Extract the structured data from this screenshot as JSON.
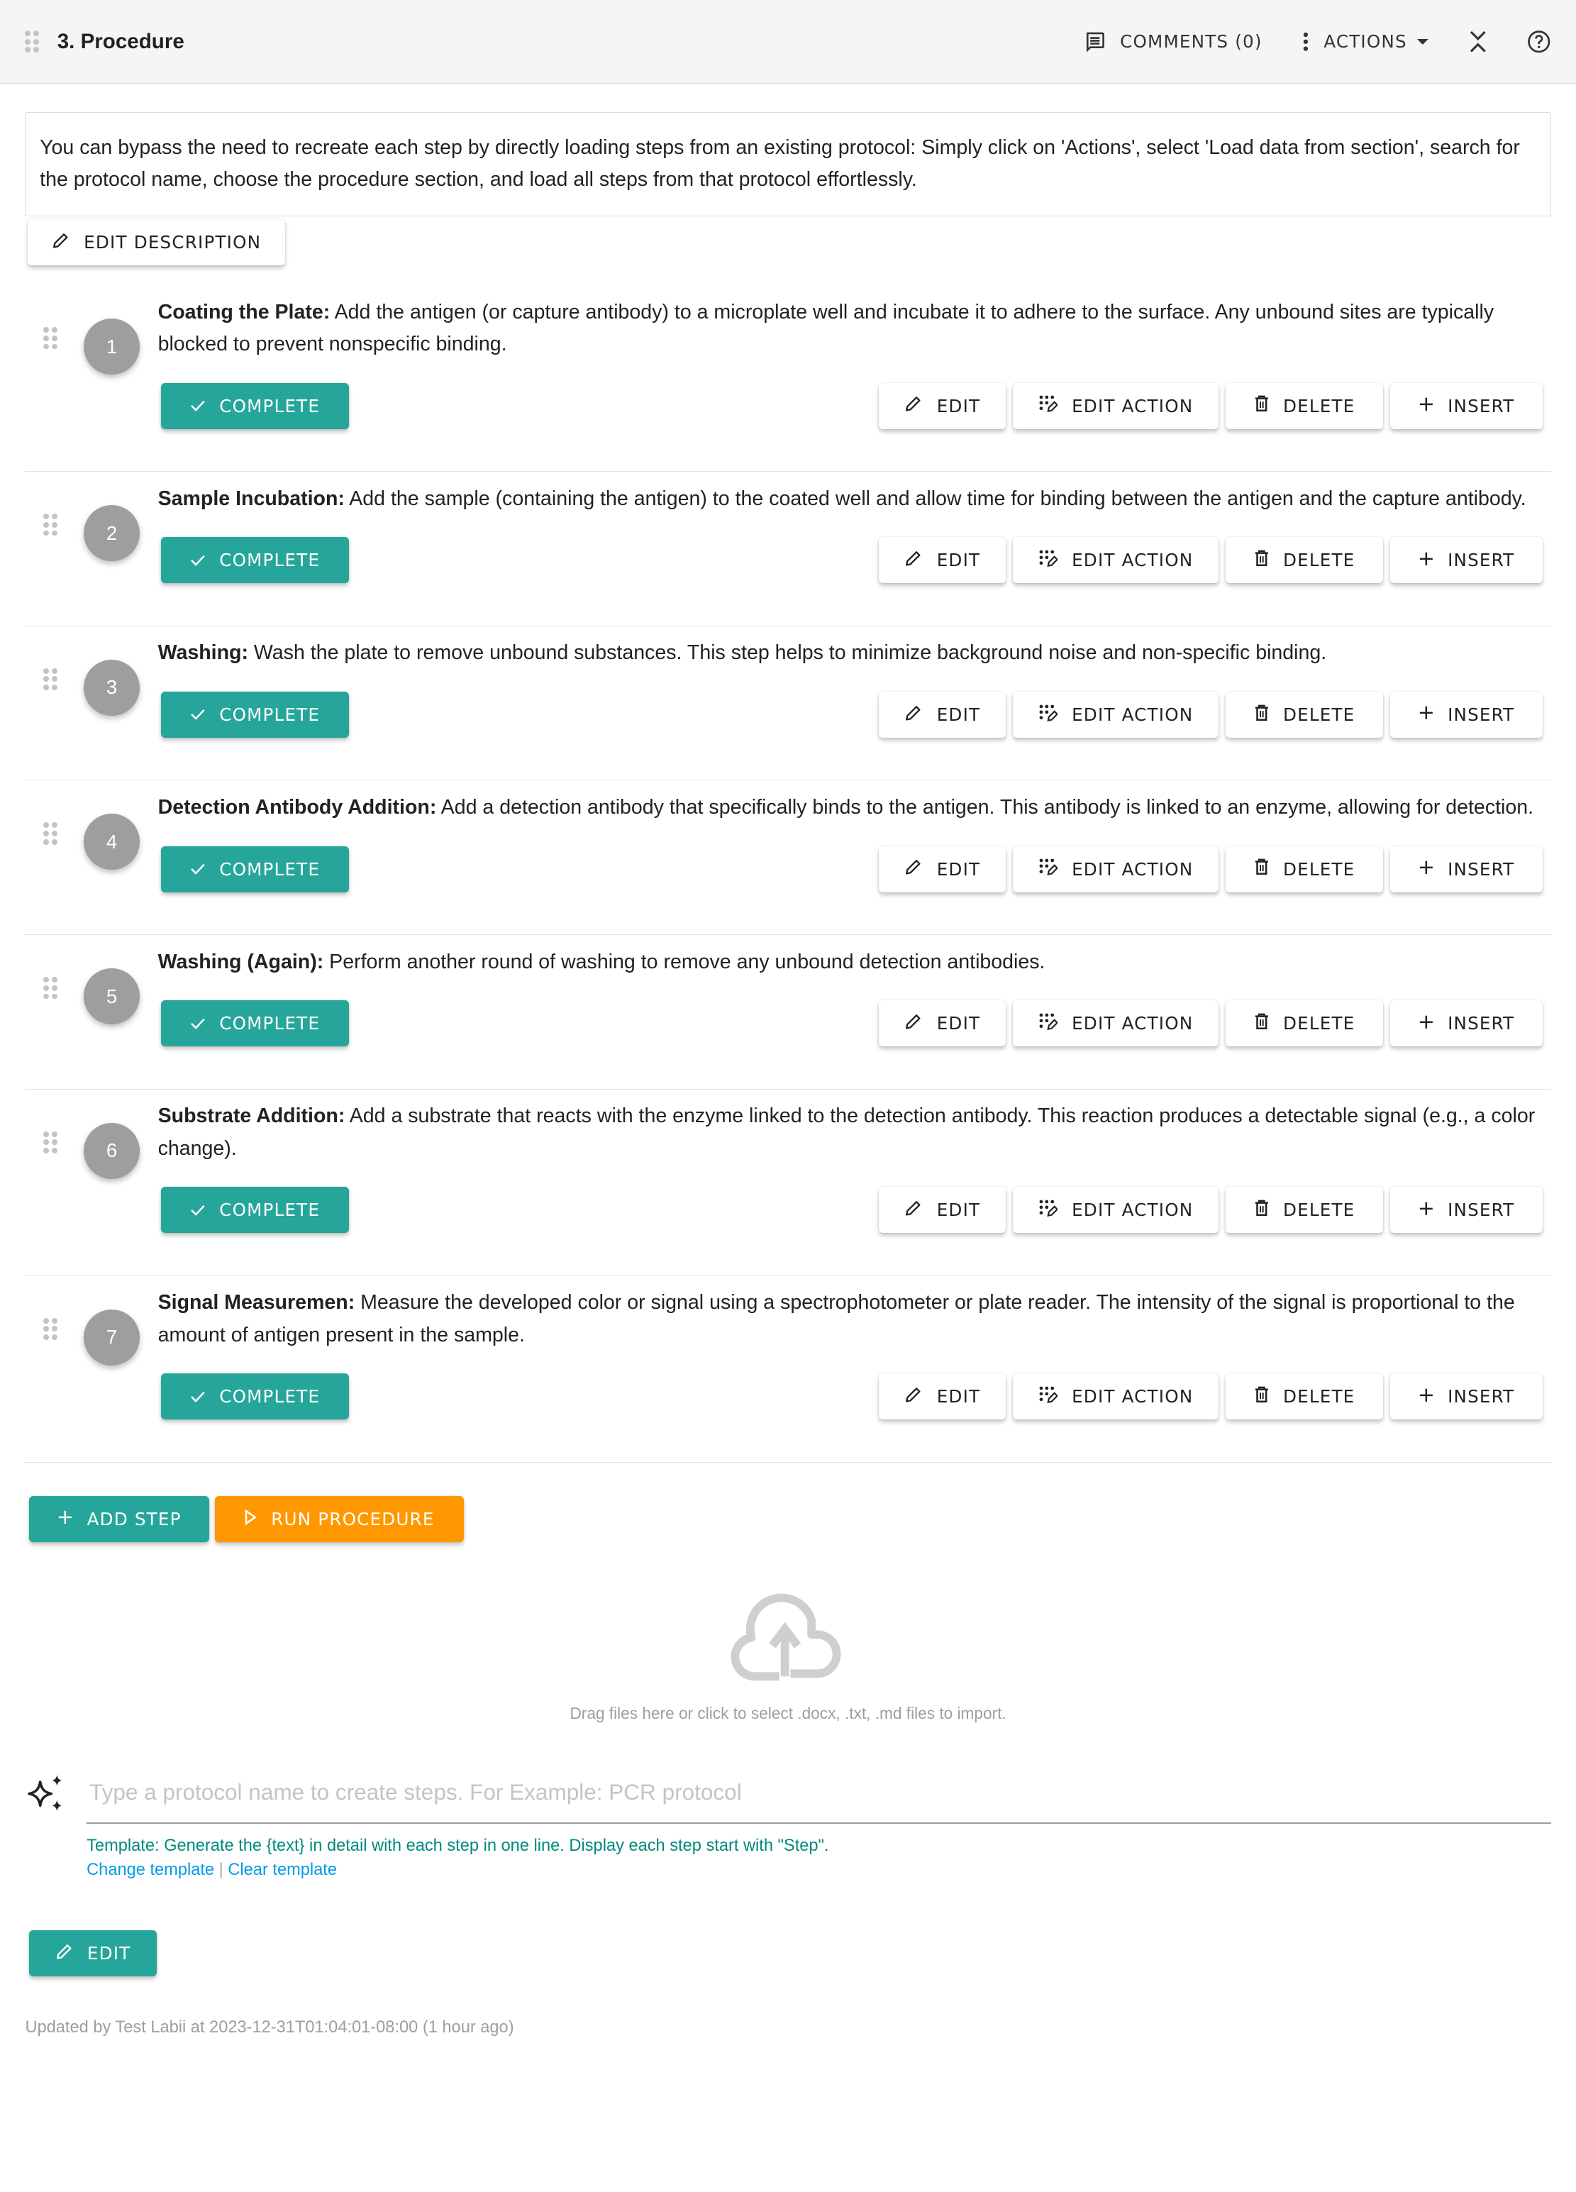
{
  "header": {
    "title": "3. Procedure",
    "comments_label": "COMMENTS (0)",
    "actions_label": "ACTIONS"
  },
  "description": {
    "text": "You can bypass the need to recreate each step by directly loading steps from an existing protocol: Simply click on 'Actions', select 'Load data from section', search for the protocol name, choose the procedure section, and load all steps from that protocol effortlessly.",
    "edit_label": "EDIT DESCRIPTION"
  },
  "step_buttons": {
    "complete": "COMPLETE",
    "edit": "EDIT",
    "edit_action": "EDIT ACTION",
    "delete": "DELETE",
    "insert": "INSERT"
  },
  "steps": [
    {
      "number": "1",
      "title": "Coating the Plate:",
      "body": " Add the antigen (or capture antibody) to a microplate well and incubate it to adhere to the surface. Any unbound sites are typically blocked to prevent nonspecific binding."
    },
    {
      "number": "2",
      "title": "Sample Incubation:",
      "body": " Add the sample (containing the antigen) to the coated well and allow time for binding between the antigen and the capture antibody."
    },
    {
      "number": "3",
      "title": "Washing:",
      "body": " Wash the plate to remove unbound substances. This step helps to minimize background noise and non-specific binding."
    },
    {
      "number": "4",
      "title": "Detection Antibody Addition:",
      "body": " Add a detection antibody that specifically binds to the antigen. This antibody is linked to an enzyme, allowing for detection."
    },
    {
      "number": "5",
      "title": "Washing (Again):",
      "body": " Perform another round of washing to remove any unbound detection antibodies."
    },
    {
      "number": "6",
      "title": "Substrate Addition:",
      "body": " Add a substrate that reacts with the enzyme linked to the detection antibody. This reaction produces a detectable signal (e.g., a color change)."
    },
    {
      "number": "7",
      "title": "Signal Measuremen:",
      "body": " Measure the developed color or signal using a spectrophotometer or plate reader. The intensity of the signal is proportional to the amount of antigen present in the sample."
    }
  ],
  "bottom": {
    "add_step_label": "ADD STEP",
    "run_procedure_label": "RUN PROCEDURE"
  },
  "dropzone": {
    "text": "Drag files here or click to select .docx, .txt, .md files to import."
  },
  "ai": {
    "placeholder": "Type a protocol name to create steps. For Example: PCR protocol",
    "value": "",
    "template_text": "Template: Generate the {text} in detail with each step in one line. Display each step start with \"Step\".",
    "change_template": "Change template",
    "separator": "|",
    "clear_template": "Clear template"
  },
  "footer": {
    "edit_label": "EDIT",
    "updated_text": "Updated by Test Labii at 2023-12-31T01:04:01-08:00 (1 hour ago)"
  },
  "colors": {
    "primary": "#26a69a",
    "accent": "#ff9800",
    "step_badge": "#9e9e9e",
    "link": "#039be5",
    "template": "#00897b"
  }
}
